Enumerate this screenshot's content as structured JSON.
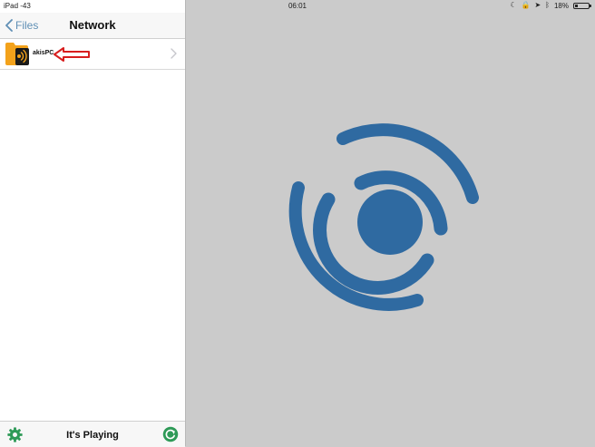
{
  "status_bar": {
    "device": "iPad -43",
    "time": "06:01",
    "battery_text": "18%",
    "battery_level": 0.18
  },
  "nav": {
    "back_label": "Files",
    "title": "Network"
  },
  "list": {
    "items": [
      {
        "label": "akisPC"
      }
    ]
  },
  "toolbar": {
    "title": "It's Playing"
  },
  "colors": {
    "accent_blue": "#2f6aa1",
    "back_blue": "#5f8fb5",
    "toolbar_green": "#2e9a57",
    "folder_orange": "#f3a21b",
    "annotation_red": "#d81e1e",
    "detail_background": "#cbcbcb"
  },
  "icons": {
    "back": "chevron-left-icon",
    "row": "folder-sound-icon",
    "row_disclosure": "chevron-right-icon",
    "settings": "gear-icon",
    "refresh": "refresh-icon",
    "logo": "sound-waves-logo-icon"
  }
}
